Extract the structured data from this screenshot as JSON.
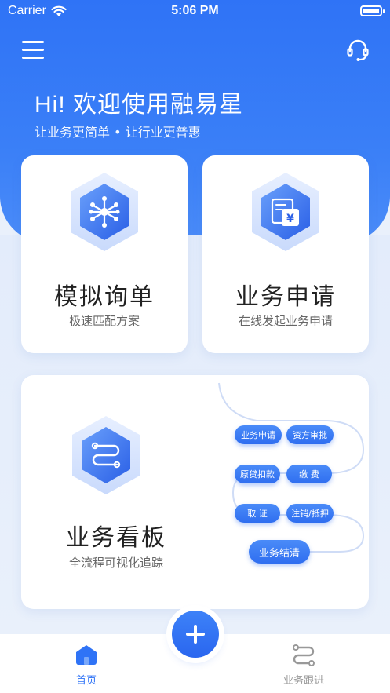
{
  "status_bar": {
    "carrier": "Carrier",
    "time": "5:06 PM"
  },
  "header": {
    "greeting": "Hi! 欢迎使用融易星",
    "slogan": "让业务更简单 • 让行业更普惠"
  },
  "cards": {
    "quote": {
      "title": "模拟询单",
      "subtitle": "极速匹配方案",
      "icon": "atom-icon"
    },
    "apply": {
      "title": "业务申请",
      "subtitle": "在线发起业务申请",
      "icon": "document-yuan-icon"
    },
    "board": {
      "title": "业务看板",
      "subtitle": "全流程可视化追踪",
      "icon": "workflow-icon"
    }
  },
  "flow_steps": [
    "业务申请",
    "资方审批",
    "原贷扣款",
    "缴 费",
    "取 证",
    "注销/抵押",
    "业务结清"
  ],
  "tabs": [
    {
      "label": "首页",
      "icon": "home-icon",
      "active": true
    },
    {
      "label": "业务跟进",
      "icon": "workflow-icon",
      "active": false
    }
  ],
  "colors": {
    "primary": "#2f73f6",
    "background": "#e9f0fb",
    "inactive": "#999999"
  }
}
